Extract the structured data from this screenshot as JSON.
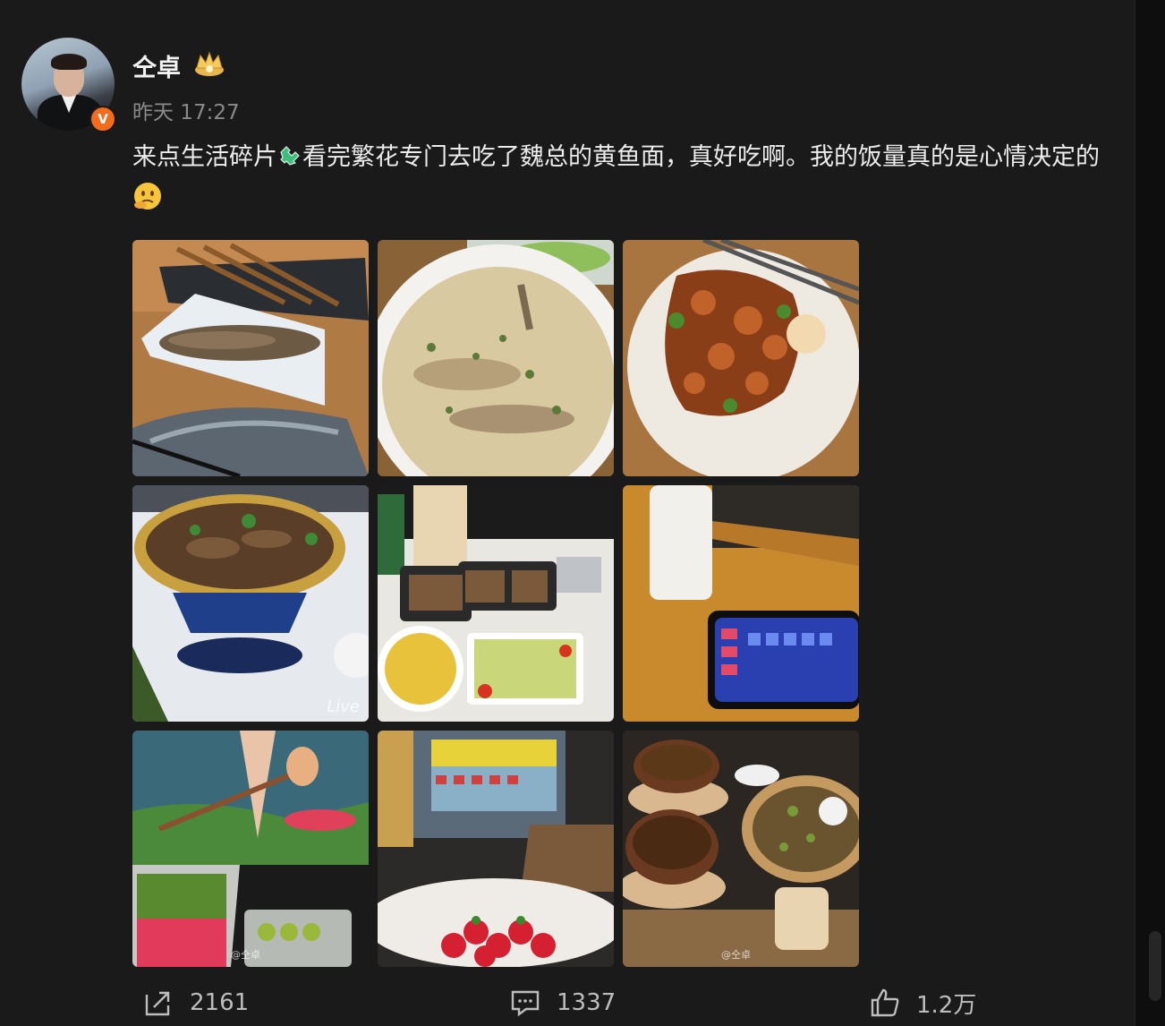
{
  "post": {
    "username": "仝卓",
    "timestamp": "昨天 17:27",
    "text_part1": "来点生活碎片",
    "text_part2": "看完繁花专门去吃了魏总的黄鱼面，真好吃啊。我的饭量真的是心情决定的",
    "avatar_badge": "V",
    "icons": {
      "member_badge": "crown-icon",
      "text_emoji_1": "puzzle-emoji",
      "text_emoji_2": "thinking-face-emoji"
    }
  },
  "photos": [
    {
      "label": "grilled-fish-skewers"
    },
    {
      "label": "fish-soup-noodles"
    },
    {
      "label": "braised-noodles-with-egg"
    },
    {
      "label": "hot-pot-stew",
      "tag": "Live"
    },
    {
      "label": "takeout-meal-boxes"
    },
    {
      "label": "phone-game-on-table"
    },
    {
      "label": "game-screen-and-fruit-boxes",
      "watermark": "@仝卓"
    },
    {
      "label": "store-and-strawberries"
    },
    {
      "label": "tea-and-claypot-rice",
      "watermark": "@仝卓"
    }
  ],
  "actions": {
    "repost_count": "2161",
    "comment_count": "1337",
    "like_count": "1.2万"
  },
  "colors": {
    "background": "#1a1a1a",
    "badge_orange": "#f36b1c"
  }
}
